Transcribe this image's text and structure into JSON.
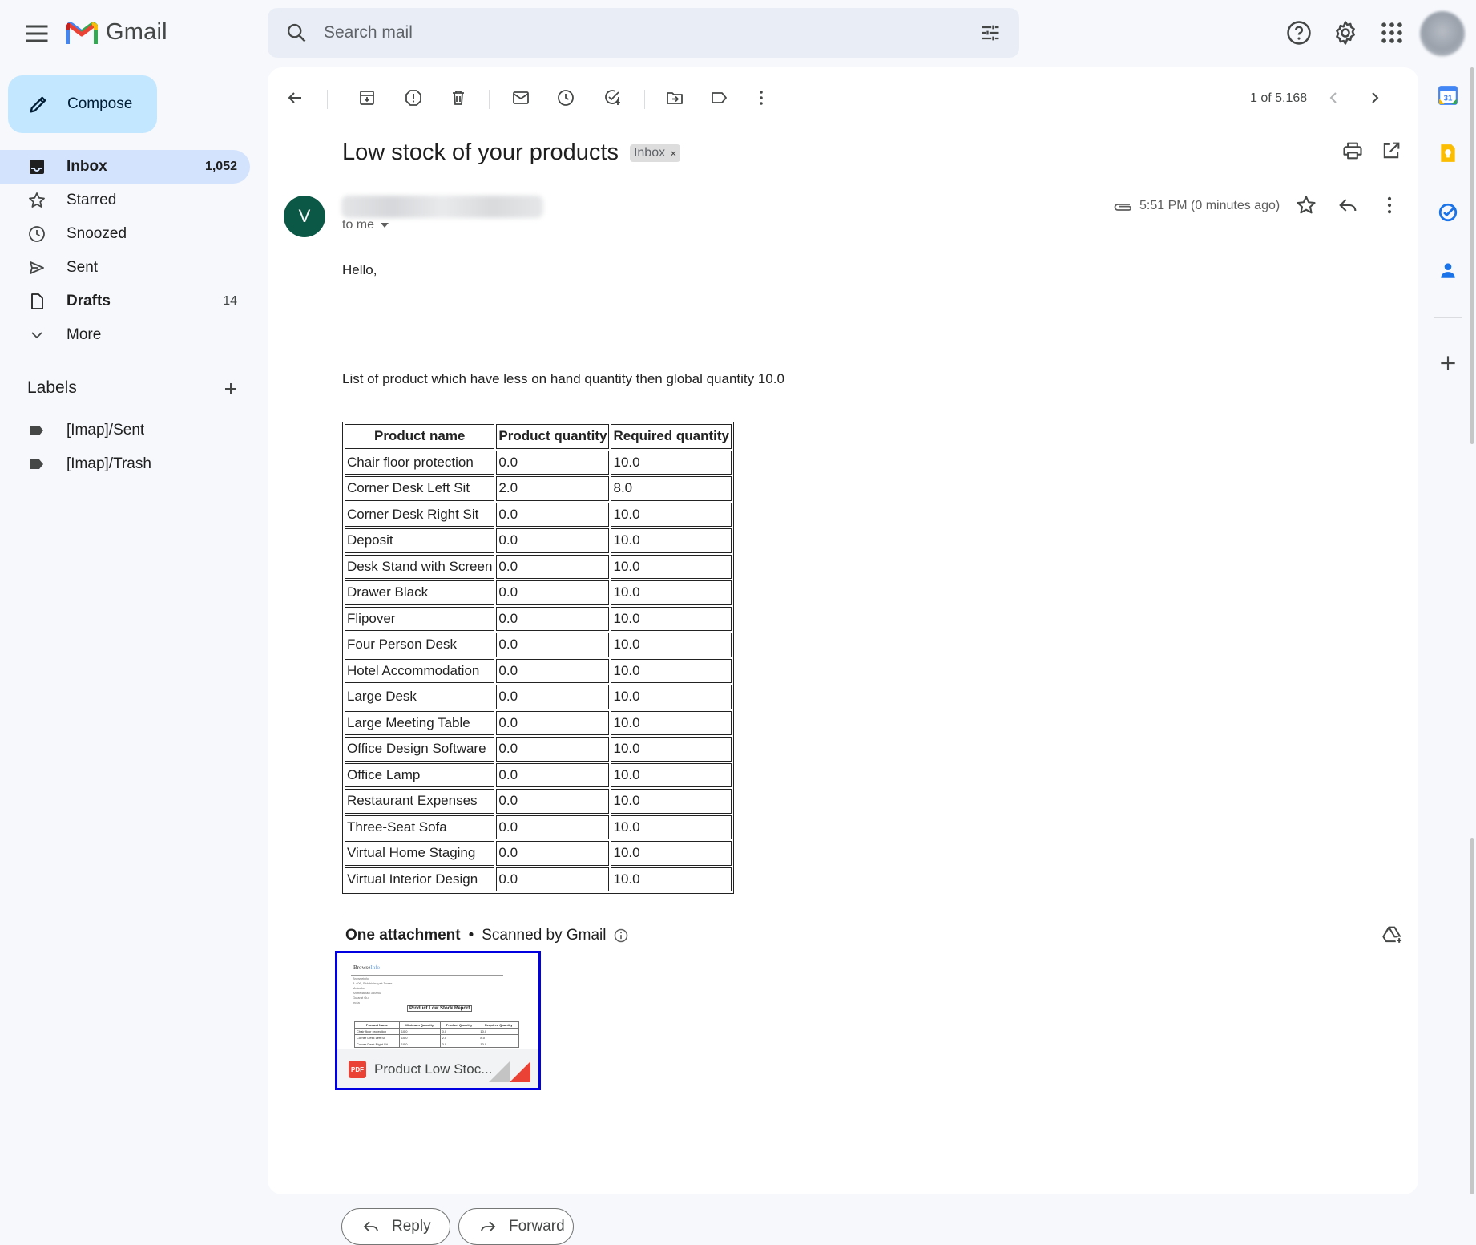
{
  "header": {
    "app_name": "Gmail",
    "search_placeholder": "Search mail"
  },
  "sidebar": {
    "compose_label": "Compose",
    "items": [
      {
        "label": "Inbox",
        "count": "1,052",
        "icon": "inbox-icon"
      },
      {
        "label": "Starred",
        "count": "",
        "icon": "star-icon"
      },
      {
        "label": "Snoozed",
        "count": "",
        "icon": "clock-icon"
      },
      {
        "label": "Sent",
        "count": "",
        "icon": "send-icon"
      },
      {
        "label": "Drafts",
        "count": "14",
        "icon": "draft-icon"
      },
      {
        "label": "More",
        "count": "",
        "icon": "chevron-down-icon"
      }
    ],
    "labels_title": "Labels",
    "labels": [
      {
        "label": "[Imap]/Sent",
        "icon": "label-icon"
      },
      {
        "label": "[Imap]/Trash",
        "icon": "label-icon"
      }
    ]
  },
  "toolbar": {
    "pager": "1 of 5,168"
  },
  "email": {
    "subject": "Low stock of your products",
    "chip": "Inbox",
    "chip_close": "×",
    "sender_initial": "V",
    "to_me": "to me",
    "time": "5:51 PM (0 minutes ago)",
    "greeting": "Hello,",
    "intro": "List of product which have less on hand quantity then global quantity 10.0",
    "table": {
      "headers": [
        "Product name",
        "Product quantity",
        "Required quantity"
      ],
      "rows": [
        [
          "Chair floor protection",
          "0.0",
          "10.0"
        ],
        [
          "Corner Desk Left Sit",
          "2.0",
          "8.0"
        ],
        [
          "Corner Desk Right Sit",
          "0.0",
          "10.0"
        ],
        [
          "Deposit",
          "0.0",
          "10.0"
        ],
        [
          "Desk Stand with Screen",
          "0.0",
          "10.0"
        ],
        [
          "Drawer Black",
          "0.0",
          "10.0"
        ],
        [
          "Flipover",
          "0.0",
          "10.0"
        ],
        [
          "Four Person Desk",
          "0.0",
          "10.0"
        ],
        [
          "Hotel Accommodation",
          "0.0",
          "10.0"
        ],
        [
          "Large Desk",
          "0.0",
          "10.0"
        ],
        [
          "Large Meeting Table",
          "0.0",
          "10.0"
        ],
        [
          "Office Design Software",
          "0.0",
          "10.0"
        ],
        [
          "Office Lamp",
          "0.0",
          "10.0"
        ],
        [
          "Restaurant Expenses",
          "0.0",
          "10.0"
        ],
        [
          "Three-Seat Sofa",
          "0.0",
          "10.0"
        ],
        [
          "Virtual Home Staging",
          "0.0",
          "10.0"
        ],
        [
          "Virtual Interior Design",
          "0.0",
          "10.0"
        ]
      ]
    },
    "attachments": {
      "title": "One attachment",
      "separator": "•",
      "scanned": "Scanned by Gmail",
      "file_name": "Product Low Stoc...",
      "file_type": "PDF",
      "thumbnail": {
        "brand_a": "Browse",
        "brand_b": "Info",
        "address": [
          "Browseinfo",
          "A-406, Siddhivinayak Tower",
          "Makarba",
          "Ahmedabad 380051",
          "Gujarat Gu",
          "India"
        ],
        "report_title": "Product Low Stock Report",
        "headers": [
          "Product Name",
          "Minimum Quantity",
          "Product Quantity",
          "Required Quantity"
        ],
        "rows": [
          [
            "Chair floor protection",
            "10.0",
            "0.0",
            "10.0"
          ],
          [
            "Corner Desk Left Sit",
            "10.0",
            "2.0",
            "8.0"
          ],
          [
            "Corner Desk Right Sit",
            "10.0",
            "0.0",
            "10.0"
          ]
        ]
      }
    },
    "reply_label": "Reply",
    "forward_label": "Forward"
  },
  "colors": {
    "compose_bg": "#c2e7ff",
    "active_nav_bg": "#d3e3fd",
    "sender_avatar": "#0b5846",
    "attachment_highlight": "#0000e0"
  }
}
